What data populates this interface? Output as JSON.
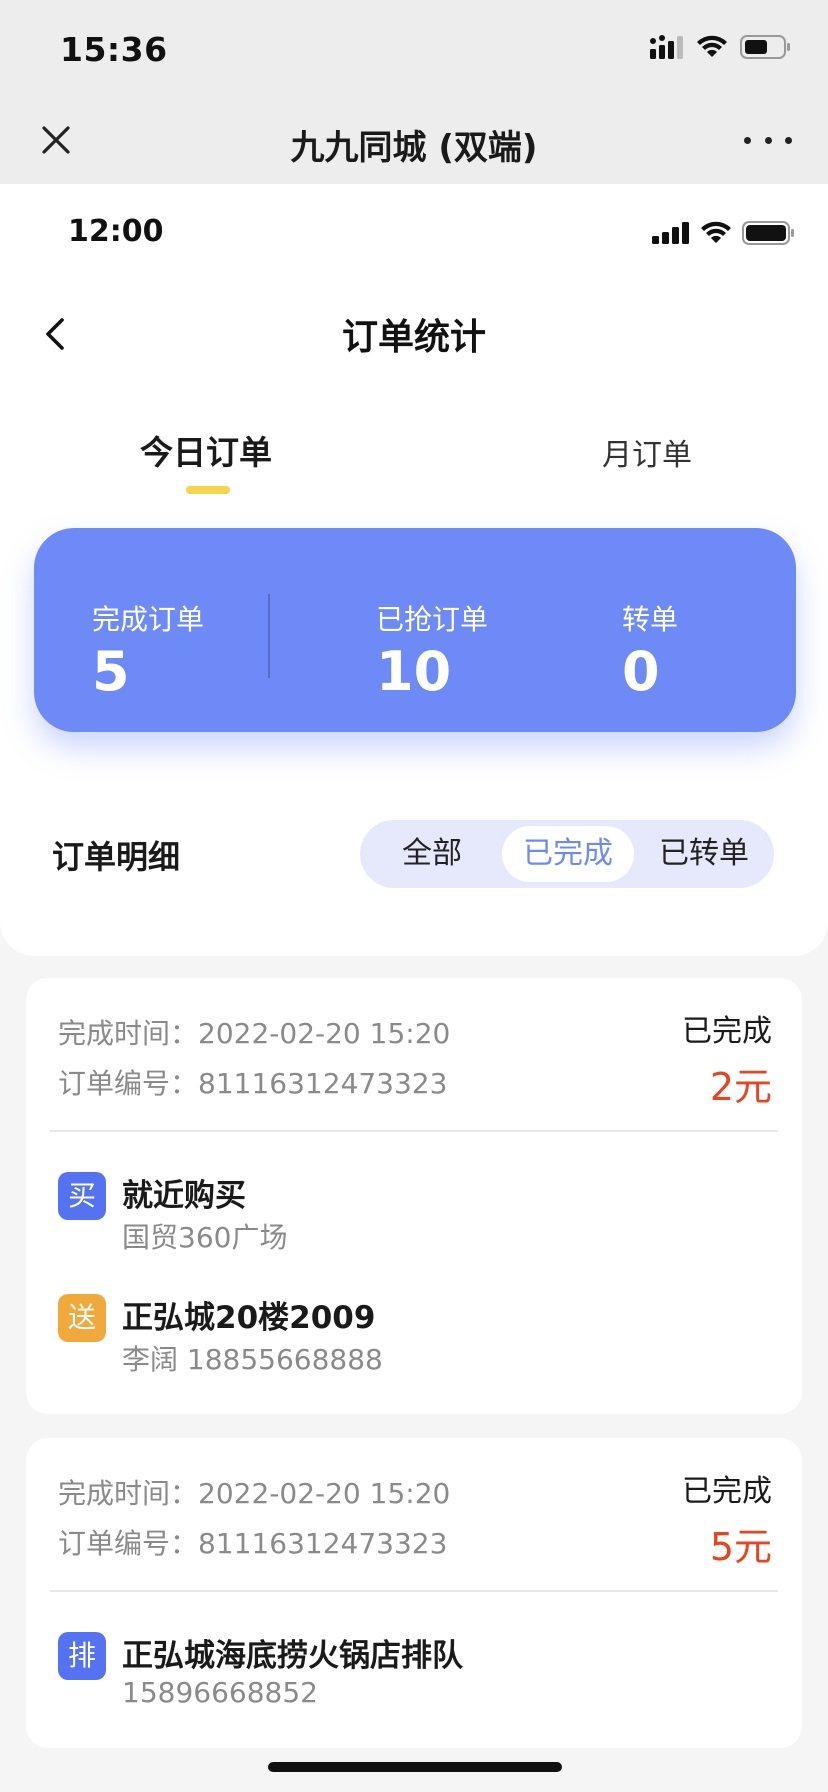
{
  "outer_status": {
    "time": "15:36"
  },
  "wechat": {
    "title": "九九同城 (双端)"
  },
  "inner_status": {
    "time": "12:00"
  },
  "header": {
    "title": "订单统计"
  },
  "tabs": [
    {
      "label": "今日订单",
      "active": true
    },
    {
      "label": "月订单",
      "active": false
    }
  ],
  "stats": [
    {
      "label": "完成订单",
      "value": "5"
    },
    {
      "label": "已抢订单",
      "value": "10"
    },
    {
      "label": "转单",
      "value": "0"
    }
  ],
  "detail": {
    "title": "订单明细",
    "filters": [
      "全部",
      "已完成",
      "已转单"
    ],
    "active_filter": "已完成"
  },
  "orders": [
    {
      "time_label": "完成时间：",
      "time": "2022-02-20 15:20",
      "no_label": "订单编号：",
      "no": "81116312473323",
      "status": "已完成",
      "price": "2元",
      "stops": [
        {
          "badge": "买",
          "title": "就近购买",
          "sub": "国贸360广场"
        },
        {
          "badge": "送",
          "title": "正弘城20楼2009",
          "sub": "李阔 18855668888"
        }
      ]
    },
    {
      "time_label": "完成时间：",
      "time": "2022-02-20 15:20",
      "no_label": "订单编号：",
      "no": "81116312473323",
      "status": "已完成",
      "price": "5元",
      "stops": [
        {
          "badge": "排",
          "title": "正弘城海底捞火锅店排队",
          "sub": "15896668852"
        }
      ]
    }
  ],
  "colors": {
    "accent": "#6e8af7",
    "tab_indicator": "#f5d547",
    "price": "#e8441f",
    "badge_blue": "#5472f2",
    "badge_orange": "#f2a93b"
  }
}
